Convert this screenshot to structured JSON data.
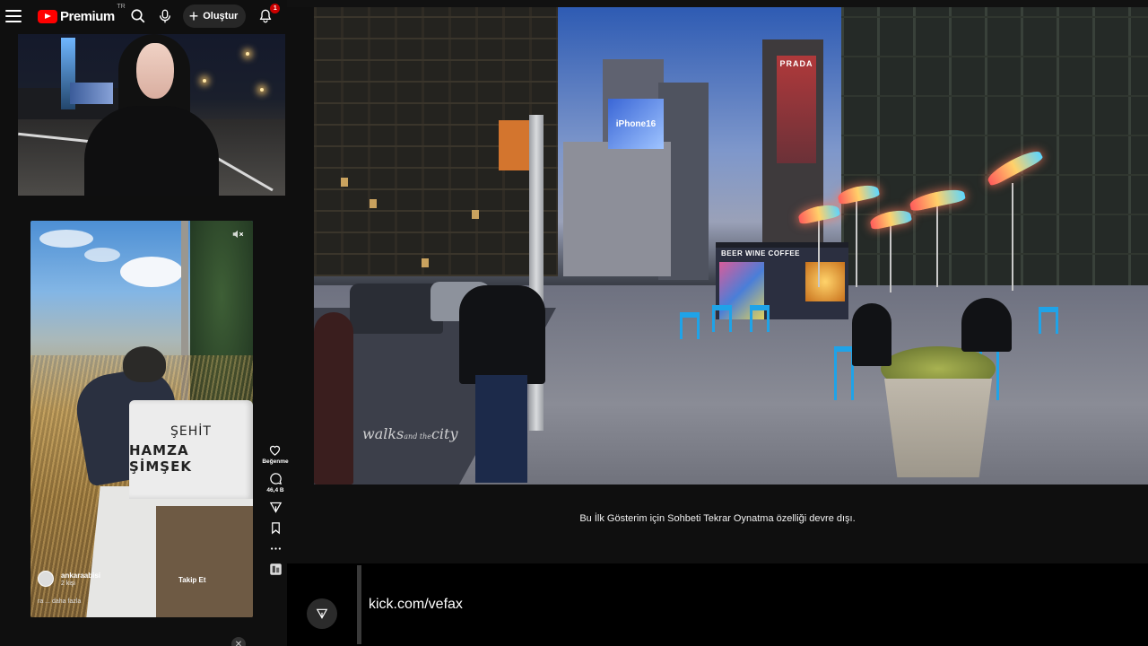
{
  "header": {
    "logo_text": "Premium",
    "logo_region": "TR",
    "create_label": "Oluştur",
    "notification_count": "1"
  },
  "short": {
    "gravestone_line1": "ŞEHİT",
    "gravestone_line2": "HAMZA ŞİMŞEK",
    "channel_name": "ankaraabisi",
    "channel_subs": "2 kişi",
    "follow_label": "Takip Et",
    "more_text": "ra ... daha fazla"
  },
  "actions": {
    "like_label": "Beğenme",
    "comments_count": "46,4 B"
  },
  "video": {
    "watermark_main": "walks",
    "watermark_small": "and the",
    "watermark_end": "city",
    "kiosk_sign": "BEER WINE COFFEE",
    "billboard_text": "iPhone16",
    "prada_text": "PRADA"
  },
  "chat": {
    "message": "Bu İlk Gösterim için Sohbeti Tekrar Oynatma özelliği devre dışı."
  },
  "stream": {
    "link_text": "kick.com/vefax"
  }
}
